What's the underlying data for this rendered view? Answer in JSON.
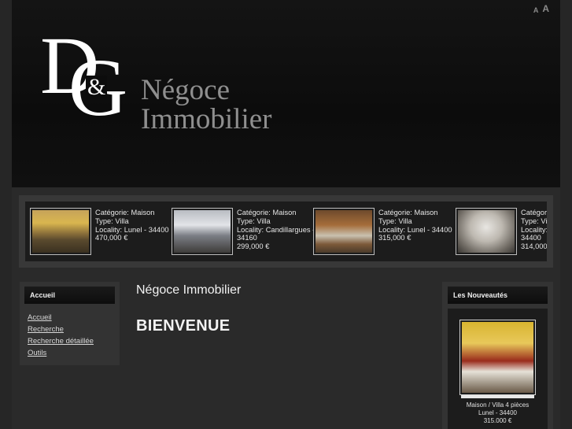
{
  "header": {
    "font_small": "A",
    "font_large": "A",
    "logo_mark": "D&G",
    "logo_text_1": "Négoce",
    "logo_text_2": "Immobilier"
  },
  "carousel": {
    "items": [
      {
        "categorie": "Catégorie: Maison",
        "type": "Type: Villa",
        "locality": "Locality: Lunel - 34400",
        "locality2": "",
        "price": "470,000 €"
      },
      {
        "categorie": "Catégorie: Maison",
        "type": "Type: Villa",
        "locality": "Locality: Candillargues -",
        "locality2": "34160",
        "price": "299,000 €"
      },
      {
        "categorie": "Catégorie: Maison",
        "type": "Type: Villa",
        "locality": "Locality: Lunel - 34400",
        "locality2": "",
        "price": "315,000 €"
      },
      {
        "categorie": "Catégori",
        "type": "Type: Vil",
        "locality": "Locality:",
        "locality2": "34400",
        "price": "314,000"
      }
    ]
  },
  "left_menu": {
    "title": "Accueil",
    "items": [
      "Accueil",
      "Recherche",
      "Recherche détaillée",
      "Outils"
    ]
  },
  "main": {
    "title": "Négoce Immobilier",
    "heading": "BIENVENUE"
  },
  "nouveautes": {
    "title": "Les Nouveautés",
    "line1": "Maison / Villa 4 pièces",
    "line2": "Lunel - 34400",
    "line3": "315.000 €"
  }
}
